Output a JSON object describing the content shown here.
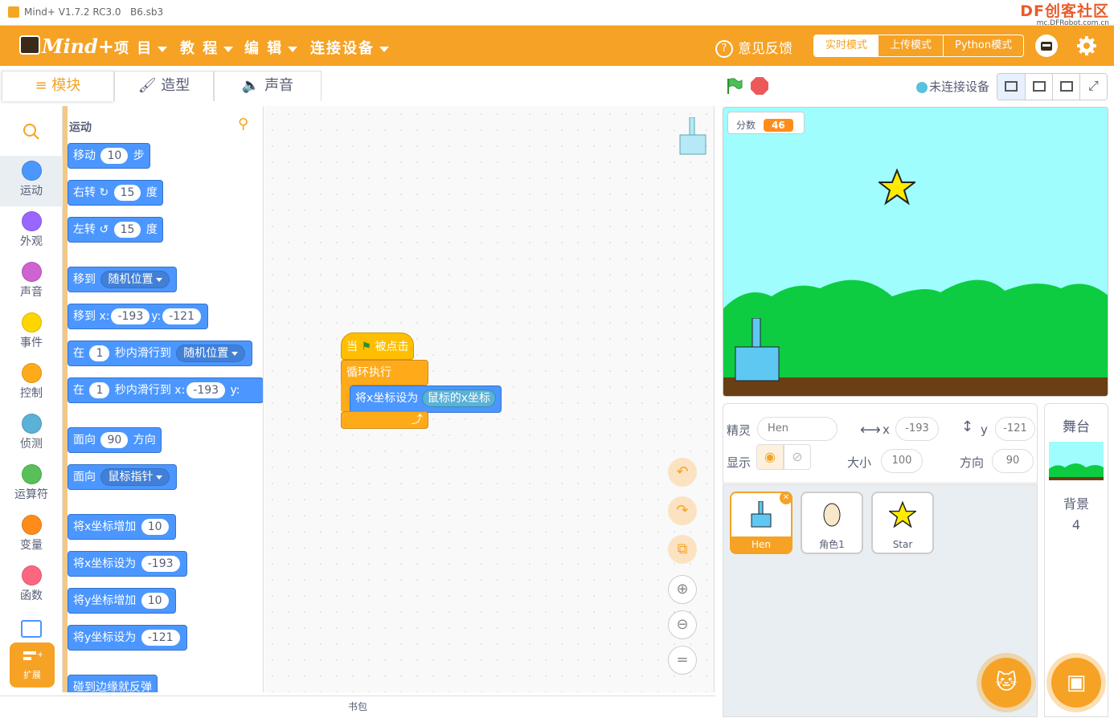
{
  "window": {
    "title": "Mind+ V1.7.2 RC3.0",
    "file": "B6.sb3"
  },
  "brand": {
    "big": "DF创客社区",
    "small": "mc.DFRobot.com.cn",
    "logo_text": "Mind+"
  },
  "menu": {
    "project": "项 目",
    "tutorial": "教 程",
    "edit": "编 辑",
    "connect": "连接设备",
    "feedback": "意见反馈"
  },
  "modes": {
    "realtime": "实时模式",
    "upload": "上传模式",
    "python": "Python模式"
  },
  "tabs": {
    "blocks": "模块",
    "costumes": "造型",
    "sounds": "声音"
  },
  "device_status": "未连接设备",
  "categories": [
    {
      "label": "运动",
      "color": "#4c97ff"
    },
    {
      "label": "外观",
      "color": "#9966ff"
    },
    {
      "label": "声音",
      "color": "#cf63cf"
    },
    {
      "label": "事件",
      "color": "#ffd500"
    },
    {
      "label": "控制",
      "color": "#ffab19"
    },
    {
      "label": "侦测",
      "color": "#5cb1d6"
    },
    {
      "label": "运算符",
      "color": "#59c059"
    },
    {
      "label": "变量",
      "color": "#ff8c1a"
    },
    {
      "label": "函数",
      "color": "#ff6680"
    }
  ],
  "extensions_label": "扩展",
  "palette": {
    "section": "运动",
    "b1": {
      "a": "移动",
      "v": "10",
      "b": "步"
    },
    "b2": {
      "a": "右转",
      "v": "15",
      "b": "度"
    },
    "b3": {
      "a": "左转",
      "v": "15",
      "b": "度"
    },
    "b4": {
      "a": "移到",
      "d": "随机位置"
    },
    "b5": {
      "a": "移到 x:",
      "x": "-193",
      "y_label": "y:",
      "y": "-121"
    },
    "b6": {
      "a": "在",
      "v": "1",
      "b": "秒内滑行到",
      "d": "随机位置"
    },
    "b7": {
      "a": "在",
      "v": "1",
      "b": "秒内滑行到 x:",
      "x": "-193",
      "y_label": "y:"
    },
    "b8": {
      "a": "面向",
      "v": "90",
      "b": "方向"
    },
    "b9": {
      "a": "面向",
      "d": "鼠标指针"
    },
    "b10": {
      "a": "将x坐标增加",
      "v": "10"
    },
    "b11": {
      "a": "将x坐标设为",
      "v": "-193"
    },
    "b12": {
      "a": "将y坐标增加",
      "v": "10"
    },
    "b13": {
      "a": "将y坐标设为",
      "v": "-121"
    },
    "b14": {
      "a": "碰到边缘就反弹"
    }
  },
  "script": {
    "hat_a": "当",
    "hat_b": "被点击",
    "loop": "循环执行",
    "set_a": "将x坐标设为",
    "set_r": "鼠标的x坐标"
  },
  "backpack": "书包",
  "stage": {
    "var_name": "分数",
    "var_value": "46"
  },
  "sprite_info": {
    "sprite_label": "精灵",
    "sprite_name": "Hen",
    "x_label": "x",
    "x": "-193",
    "y_label": "y",
    "y": "-121",
    "show_label": "显示",
    "size_label": "大小",
    "size": "100",
    "dir_label": "方向",
    "dir": "90"
  },
  "sprites": [
    {
      "name": "Hen"
    },
    {
      "name": "角色1"
    },
    {
      "name": "Star"
    }
  ],
  "stage_pane": {
    "title": "舞台",
    "backdrop_label": "背景",
    "backdrop_count": "4"
  }
}
